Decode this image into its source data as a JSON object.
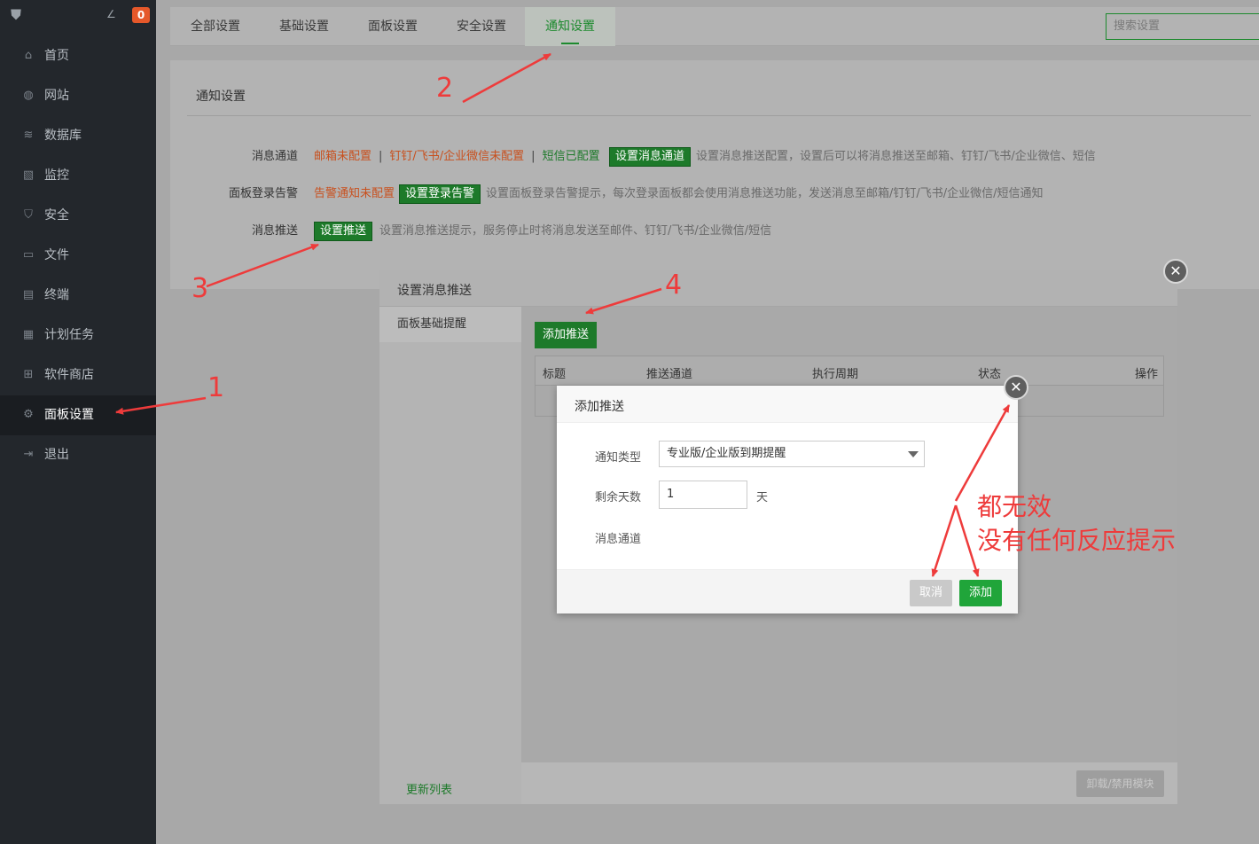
{
  "sidebar": {
    "badge": "0",
    "items": [
      {
        "label": "首页",
        "icon": "home-icon"
      },
      {
        "label": "网站",
        "icon": "globe-icon"
      },
      {
        "label": "数据库",
        "icon": "database-icon"
      },
      {
        "label": "监控",
        "icon": "monitor-icon"
      },
      {
        "label": "安全",
        "icon": "shield-icon"
      },
      {
        "label": "文件",
        "icon": "folder-icon"
      },
      {
        "label": "终端",
        "icon": "terminal-icon"
      },
      {
        "label": "计划任务",
        "icon": "calendar-icon"
      },
      {
        "label": "软件商店",
        "icon": "grid-icon"
      },
      {
        "label": "面板设置",
        "icon": "gear-icon"
      },
      {
        "label": "退出",
        "icon": "logout-icon"
      }
    ]
  },
  "tabs": [
    "全部设置",
    "基础设置",
    "面板设置",
    "安全设置",
    "通知设置"
  ],
  "search": {
    "placeholder": "搜索设置"
  },
  "panel": {
    "title": "通知设置",
    "row1": {
      "label": "消息通道",
      "mail": "邮箱未配置",
      "sep": "|",
      "dingding": "钉钉/飞书/企业微信未配置",
      "sms": "短信已配置",
      "button": "设置消息通道",
      "desc": "设置消息推送配置，设置后可以将消息推送至邮箱、钉钉/飞书/企业微信、短信"
    },
    "row2": {
      "label": "面板登录告警",
      "status": "告警通知未配置",
      "button": "设置登录告警",
      "desc": "设置面板登录告警提示，每次登录面板都会使用消息推送功能，发送消息至邮箱/钉钉/飞书/企业微信/短信通知"
    },
    "row3": {
      "label": "消息推送",
      "button": "设置推送",
      "desc": "设置消息推送提示，服务停止时将消息发送至邮件、钉钉/飞书/企业微信/短信"
    }
  },
  "dialog1": {
    "title": "设置消息推送",
    "left_item": "面板基础提醒",
    "refresh": "更新列表",
    "add_button": "添加推送",
    "columns": [
      "标题",
      "推送通道",
      "执行周期",
      "状态",
      "操作"
    ],
    "uninstall_button": "卸载/禁用模块"
  },
  "dialog2": {
    "title": "添加推送",
    "type_label": "通知类型",
    "type_value": "专业版/企业版到期提醒",
    "days_label": "剩余天数",
    "days_value": "1",
    "days_unit": "天",
    "channel_label": "消息通道",
    "cancel": "取消",
    "add": "添加"
  },
  "annotations": {
    "n1": "1",
    "n2": "2",
    "n3": "3",
    "n4": "4",
    "line1": "都无效",
    "line2": "没有任何反应提示",
    "color": "#ee3b3b"
  }
}
